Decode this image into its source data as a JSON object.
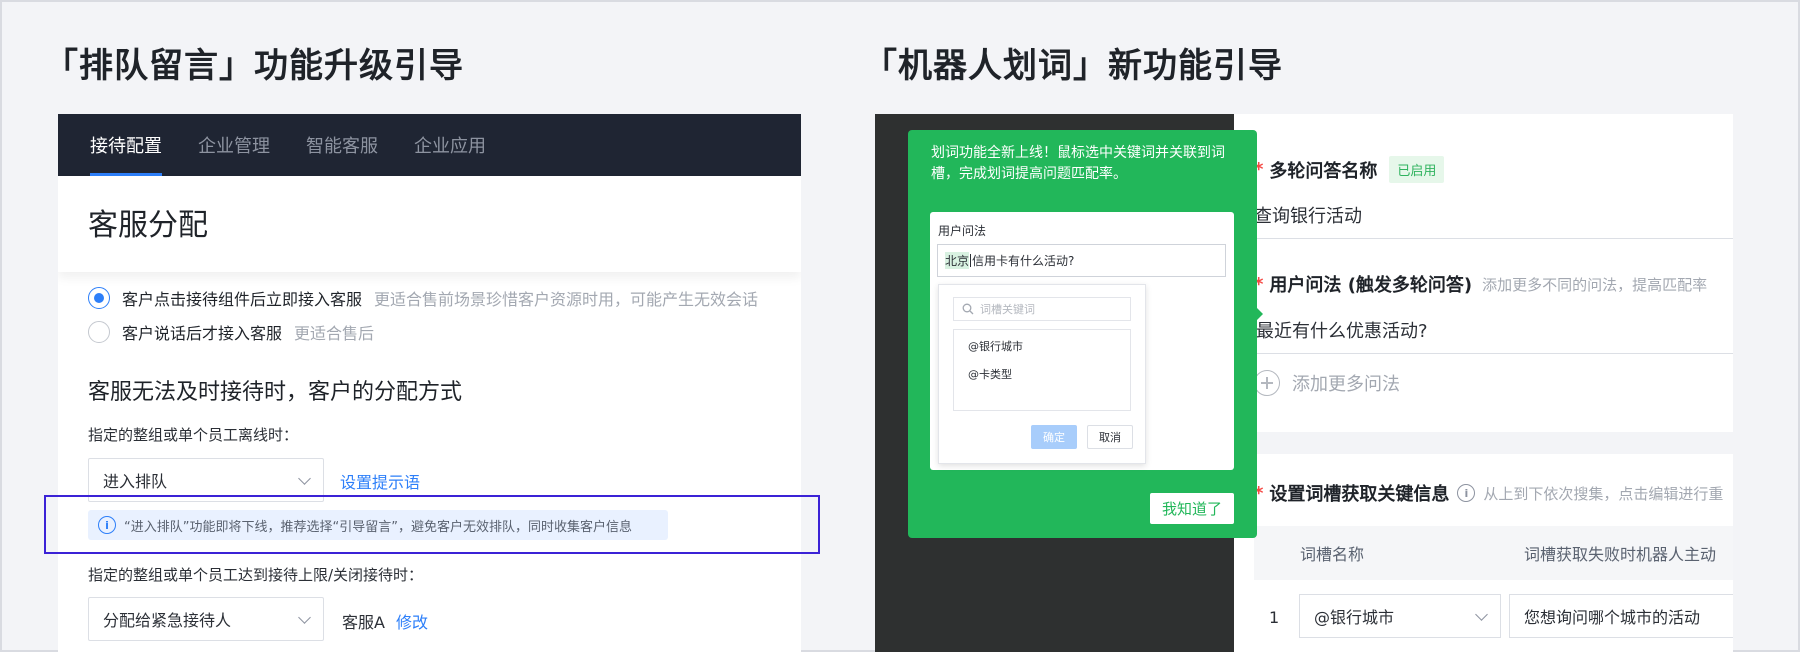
{
  "left": {
    "section_title": "「排队留言」功能升级引导",
    "nav_tabs": [
      "接待配置",
      "企业管理",
      "智能客服",
      "企业应用"
    ],
    "page_title": "客服分配",
    "radio_options": [
      {
        "label": "客户点击接待组件后立即接入客服",
        "hint": "更适合售前场景珍惜客户资源时用，可能产生无效会话",
        "checked": true
      },
      {
        "label": "客户说话后才接入客服",
        "hint": "更适合售后",
        "checked": false
      }
    ],
    "subheading": "客服无法及时接待时，客户的分配方式",
    "offline_label": "指定的整组或单个员工离线时：",
    "offline_select": "进入排队",
    "prompt_link": "设置提示语",
    "notice": "“进入排队”功能即将下线，推荐选择“引导留言”，避免客户无效排队，同时收集客户信息",
    "limit_label": "指定的整组或单个员工达到接待上限/关闭接待时：",
    "limit_select": "分配给紧急接待人",
    "limit_agent": "客服A",
    "modify_link": "修改"
  },
  "right": {
    "section_title": "「机器人划词」新功能引导",
    "popover": {
      "text": "划词功能全新上线！鼠标选中关键词并关联到词槽，完成划词提高问题匹配率。",
      "mock_label": "用户问法",
      "mock_input_highlight": "北京",
      "mock_input_rest": "信用卡有什么活动?",
      "mock_search_placeholder": "词槽关键词",
      "mock_items": [
        "@银行城市",
        "@卡类型"
      ],
      "mock_ok": "确定",
      "mock_cancel": "取消",
      "got_it": "我知道了"
    },
    "form": {
      "multi_qa_name_label": "多轮问答名称",
      "enabled_badge": "已启用",
      "multi_qa_name_value": "查询银行活动",
      "user_question_label": "用户问法 (触发多轮问答)",
      "user_question_hint": "添加更多不同的问法，提高匹配率",
      "user_question_value": "最近有什么优惠活动?",
      "add_more": "添加更多问法",
      "slot_label": "设置词槽获取关键信息",
      "slot_hint": "从上到下依次搜集，点击编辑进行重",
      "table_headers": [
        "词槽名称",
        "词槽获取失败时机器人主动"
      ],
      "row_index": "1",
      "row_slot": "@银行城市",
      "row_prompt": "您想询问哪个城市的活动"
    }
  }
}
